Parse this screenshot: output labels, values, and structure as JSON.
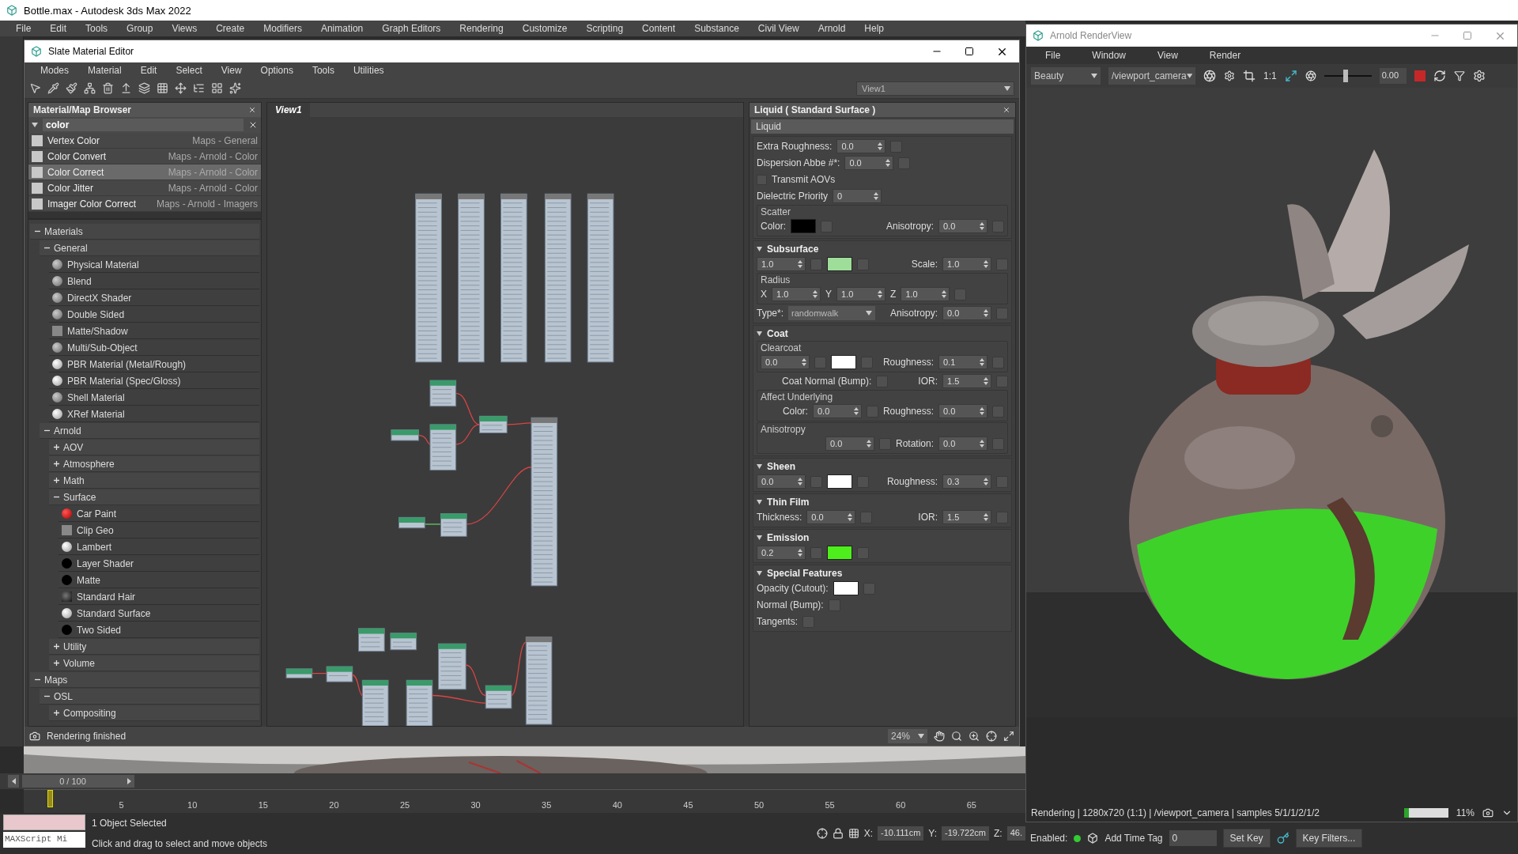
{
  "app": {
    "title": "Bottle.max - Autodesk 3ds Max 2022",
    "menu": [
      "File",
      "Edit",
      "Tools",
      "Group",
      "Views",
      "Create",
      "Modifiers",
      "Animation",
      "Graph Editors",
      "Rendering",
      "Customize",
      "Scripting",
      "Content",
      "Substance",
      "Civil View",
      "Arnold",
      "Help"
    ]
  },
  "slate": {
    "title": "Slate Material Editor",
    "menu": [
      "Modes",
      "Material",
      "Edit",
      "Select",
      "View",
      "Options",
      "Tools",
      "Utilities"
    ],
    "view_select": "View1",
    "browser": {
      "title": "Material/Map Browser",
      "search": "color",
      "results": [
        {
          "name": "Vertex Color",
          "category": "Maps - General",
          "selected": false
        },
        {
          "name": "Color Convert",
          "category": "Maps - Arnold - Color",
          "selected": false
        },
        {
          "name": "Color Correct",
          "category": "Maps - Arnold - Color",
          "selected": true
        },
        {
          "name": "Color Jitter",
          "category": "Maps - Arnold - Color",
          "selected": false
        },
        {
          "name": "Imager Color Correct",
          "category": "Maps - Arnold - Imagers",
          "selected": false
        }
      ],
      "tree": [
        {
          "label": "Materials",
          "expanded": true,
          "children": [
            {
              "label": "General",
              "expanded": true,
              "children": [
                {
                  "label": "Physical Material",
                  "kind": "sphere"
                },
                {
                  "label": "Blend",
                  "kind": "sphere"
                },
                {
                  "label": "DirectX Shader",
                  "kind": "sphere"
                },
                {
                  "label": "Double Sided",
                  "kind": "sphere"
                },
                {
                  "label": "Matte/Shadow",
                  "kind": "flat"
                },
                {
                  "label": "Multi/Sub-Object",
                  "kind": "sphere"
                },
                {
                  "label": "PBR Material (Metal/Rough)",
                  "kind": "gloss"
                },
                {
                  "label": "PBR Material (Spec/Gloss)",
                  "kind": "gloss"
                },
                {
                  "label": "Shell Material",
                  "kind": "sphere"
                },
                {
                  "label": "XRef Material",
                  "kind": "gloss"
                }
              ]
            },
            {
              "label": "Arnold",
              "expanded": true,
              "children": [
                {
                  "label": "AOV",
                  "expanded": false
                },
                {
                  "label": "Atmosphere",
                  "expanded": false
                },
                {
                  "label": "Math",
                  "expanded": false
                },
                {
                  "label": "Surface",
                  "expanded": true,
                  "children": [
                    {
                      "label": "Car Paint",
                      "kind": "red"
                    },
                    {
                      "label": "Clip Geo",
                      "kind": "flat"
                    },
                    {
                      "label": "Lambert",
                      "kind": "gloss"
                    },
                    {
                      "label": "Layer Shader",
                      "kind": "black"
                    },
                    {
                      "label": "Matte",
                      "kind": "black"
                    },
                    {
                      "label": "Standard Hair",
                      "kind": "hair"
                    },
                    {
                      "label": "Standard Surface",
                      "kind": "gloss"
                    },
                    {
                      "label": "Two Sided",
                      "kind": "black"
                    }
                  ]
                },
                {
                  "label": "Utility",
                  "expanded": false
                },
                {
                  "label": "Volume",
                  "expanded": false
                }
              ]
            }
          ]
        },
        {
          "label": "Maps",
          "expanded": true,
          "children": [
            {
              "label": "OSL",
              "expanded": true,
              "children": [
                {
                  "label": "Compositing",
                  "expanded": false
                }
              ]
            }
          ]
        }
      ]
    },
    "view_tab": "View1",
    "params": {
      "title": "Liquid  ( Standard Surface )",
      "name": "Liquid",
      "sections": [
        {
          "blocks": [
            {
              "rows": [
                [
                  {
                    "kind": "label",
                    "text": "Extra Roughness:"
                  },
                  {
                    "kind": "spinner",
                    "value": "0.0"
                  },
                  {
                    "kind": "map"
                  }
                ],
                [
                  {
                    "kind": "label",
                    "text": "Dispersion Abbe #*:"
                  },
                  {
                    "kind": "spinner",
                    "value": "0.0"
                  },
                  {
                    "kind": "map"
                  }
                ],
                [
                  {
                    "kind": "check",
                    "text": "Transmit AOVs",
                    "checked": false
                  }
                ],
                [
                  {
                    "kind": "label",
                    "text": "Dielectric Priority"
                  },
                  {
                    "kind": "spinner",
                    "value": "0"
                  }
                ]
              ]
            },
            {
              "legend": "Scatter",
              "rows": [
                [
                  {
                    "kind": "label",
                    "text": "Color:"
                  },
                  {
                    "kind": "swatch",
                    "color": "#000000"
                  },
                  {
                    "kind": "map"
                  },
                  {
                    "kind": "gap"
                  },
                  {
                    "kind": "label",
                    "text": "Anisotropy:"
                  },
                  {
                    "kind": "spinner",
                    "value": "0.0"
                  },
                  {
                    "kind": "map"
                  }
                ]
              ]
            }
          ]
        },
        {
          "title": "Subsurface",
          "expanded": true,
          "blocks": [
            {
              "rows": [
                [
                  {
                    "kind": "spinner",
                    "value": "1.0"
                  },
                  {
                    "kind": "map"
                  },
                  {
                    "kind": "swatch",
                    "color": "#9ede9a"
                  },
                  {
                    "kind": "map"
                  },
                  {
                    "kind": "gap"
                  },
                  {
                    "kind": "label",
                    "text": "Scale:"
                  },
                  {
                    "kind": "spinner",
                    "value": "1.0"
                  },
                  {
                    "kind": "map"
                  }
                ]
              ]
            },
            {
              "legend": "Radius",
              "rows": [
                [
                  {
                    "kind": "label",
                    "text": "X"
                  },
                  {
                    "kind": "spinner",
                    "value": "1.0"
                  },
                  {
                    "kind": "label",
                    "text": "Y"
                  },
                  {
                    "kind": "spinner",
                    "value": "1.0"
                  },
                  {
                    "kind": "label",
                    "text": "Z"
                  },
                  {
                    "kind": "spinner",
                    "value": "1.0"
                  },
                  {
                    "kind": "map"
                  }
                ]
              ]
            },
            {
              "rows": [
                [
                  {
                    "kind": "label",
                    "text": "Type*:"
                  },
                  {
                    "kind": "dropdown",
                    "value": "randomwalk"
                  },
                  {
                    "kind": "gap"
                  },
                  {
                    "kind": "label",
                    "text": "Anisotropy:"
                  },
                  {
                    "kind": "spinner",
                    "value": "0.0"
                  },
                  {
                    "kind": "map"
                  }
                ]
              ]
            }
          ]
        },
        {
          "title": "Coat",
          "expanded": true,
          "blocks": [
            {
              "legend": "Clearcoat",
              "rows": [
                [
                  {
                    "kind": "spinner",
                    "value": "0.0"
                  },
                  {
                    "kind": "map"
                  },
                  {
                    "kind": "swatch",
                    "color": "#ffffff"
                  },
                  {
                    "kind": "map"
                  },
                  {
                    "kind": "gap"
                  },
                  {
                    "kind": "label",
                    "text": "Roughness:"
                  },
                  {
                    "kind": "spinner",
                    "value": "0.1"
                  },
                  {
                    "kind": "map"
                  }
                ]
              ]
            },
            {
              "rows": [
                [
                  {
                    "kind": "gap"
                  },
                  {
                    "kind": "label",
                    "text": "Coat Normal (Bump):"
                  },
                  {
                    "kind": "map"
                  },
                  {
                    "kind": "gap"
                  },
                  {
                    "kind": "label",
                    "text": "IOR:"
                  },
                  {
                    "kind": "spinner",
                    "value": "1.5"
                  },
                  {
                    "kind": "map"
                  }
                ]
              ]
            },
            {
              "legend": "Affect Underlying",
              "rows": [
                [
                  {
                    "kind": "gap"
                  },
                  {
                    "kind": "label",
                    "text": "Color:"
                  },
                  {
                    "kind": "spinner",
                    "value": "0.0"
                  },
                  {
                    "kind": "map"
                  },
                  {
                    "kind": "label",
                    "text": "Roughness:"
                  },
                  {
                    "kind": "spinner",
                    "value": "0.0"
                  },
                  {
                    "kind": "map"
                  }
                ]
              ]
            },
            {
              "legend": "Anisotropy",
              "rows": [
                [
                  {
                    "kind": "gap"
                  },
                  {
                    "kind": "spinner",
                    "value": "0.0"
                  },
                  {
                    "kind": "map"
                  },
                  {
                    "kind": "label",
                    "text": "Rotation:"
                  },
                  {
                    "kind": "spinner",
                    "value": "0.0"
                  },
                  {
                    "kind": "map"
                  }
                ]
              ]
            }
          ]
        },
        {
          "title": "Sheen",
          "expanded": true,
          "blocks": [
            {
              "rows": [
                [
                  {
                    "kind": "spinner",
                    "value": "0.0"
                  },
                  {
                    "kind": "map"
                  },
                  {
                    "kind": "swatch",
                    "color": "#ffffff"
                  },
                  {
                    "kind": "map"
                  },
                  {
                    "kind": "gap"
                  },
                  {
                    "kind": "label",
                    "text": "Roughness:"
                  },
                  {
                    "kind": "spinner",
                    "value": "0.3"
                  },
                  {
                    "kind": "map"
                  }
                ]
              ]
            }
          ]
        },
        {
          "title": "Thin Film",
          "expanded": true,
          "blocks": [
            {
              "rows": [
                [
                  {
                    "kind": "label",
                    "text": "Thickness:"
                  },
                  {
                    "kind": "spinner",
                    "value": "0.0"
                  },
                  {
                    "kind": "map"
                  },
                  {
                    "kind": "gap"
                  },
                  {
                    "kind": "label",
                    "text": "IOR:"
                  },
                  {
                    "kind": "spinner",
                    "value": "1.5"
                  },
                  {
                    "kind": "map"
                  }
                ]
              ]
            }
          ]
        },
        {
          "title": "Emission",
          "expanded": true,
          "blocks": [
            {
              "rows": [
                [
                  {
                    "kind": "spinner",
                    "value": "0.2"
                  },
                  {
                    "kind": "map"
                  },
                  {
                    "kind": "swatch",
                    "color": "#4dee1c"
                  },
                  {
                    "kind": "map"
                  }
                ]
              ]
            }
          ]
        },
        {
          "title": "Special Features",
          "expanded": true,
          "blocks": [
            {
              "rows": [
                [
                  {
                    "kind": "label",
                    "text": "Opacity (Cutout):"
                  },
                  {
                    "kind": "swatch",
                    "color": "#ffffff"
                  },
                  {
                    "kind": "map"
                  }
                ],
                [
                  {
                    "kind": "label",
                    "text": "Normal (Bump):"
                  },
                  {
                    "kind": "map"
                  }
                ],
                [
                  {
                    "kind": "label",
                    "text": "Tangents:"
                  },
                  {
                    "kind": "map"
                  }
                ]
              ]
            }
          ]
        }
      ]
    },
    "status": "Rendering finished",
    "zoom": "24%"
  },
  "render_view": {
    "title": "Arnold RenderView",
    "menu": [
      "File",
      "Window",
      "View",
      "Render"
    ],
    "aov": "Beauty",
    "camera": "/viewport_camera",
    "ratio": "1:1",
    "exposure": {
      "level": 0.45,
      "value": "0.00"
    },
    "status": "Rendering | 1280x720 (1:1) | /viewport_camera | samples 5/1/1/2/1/2",
    "progress": {
      "level": 0.11,
      "text": "11%"
    }
  },
  "timeline": {
    "frame": "0 / 100",
    "level": 0,
    "ticks": [
      "5",
      "10",
      "15",
      "20",
      "25",
      "30",
      "35",
      "40",
      "45",
      "50",
      "55",
      "60",
      "65"
    ]
  },
  "status_bar": {
    "maxscript": "MAXScript Mi",
    "selection": "1 Object Selected",
    "prompt": "Click and drag to select and move objects",
    "coords": [
      {
        "label": "X:",
        "value": "-10.111cm"
      },
      {
        "label": "Y:",
        "value": "-19.722cm"
      },
      {
        "label": "Z:",
        "value": "46."
      }
    ],
    "enabled_label": "Enabled:",
    "enabled": true,
    "time_tag": "Add Time Tag",
    "frame": "0",
    "set_key": "Set Key",
    "key_filters": "Key Filters..."
  }
}
